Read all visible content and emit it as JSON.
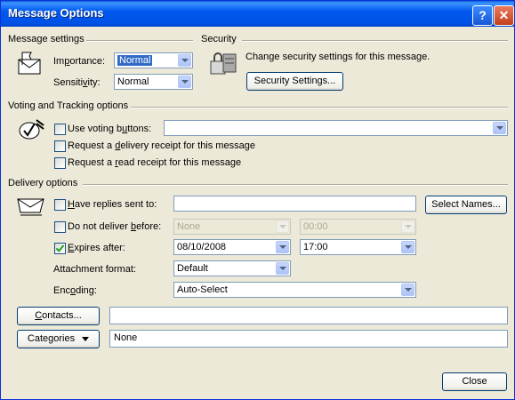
{
  "window": {
    "title": "Message Options",
    "help": "?",
    "close": "✕"
  },
  "message_settings": {
    "heading": "Message settings",
    "importance_label": "Importance:",
    "importance_value": "Normal",
    "sensitivity_label": "Sensitivity:",
    "sensitivity_value": "Normal"
  },
  "security": {
    "heading": "Security",
    "description": "Change security settings for this message.",
    "button": "Security Settings..."
  },
  "voting": {
    "heading": "Voting and Tracking options",
    "use_voting_label": "Use voting buttons:",
    "use_voting_value": "",
    "use_voting_checked": false,
    "delivery_receipt_label": "Request a delivery receipt for this message",
    "read_receipt_label": "Request a read receipt for this message"
  },
  "delivery": {
    "heading": "Delivery options",
    "have_replies_label": "Have replies sent to:",
    "have_replies_value": "",
    "select_names_button": "Select Names...",
    "do_not_deliver_label": "Do not deliver before:",
    "do_not_deliver_date": "None",
    "do_not_deliver_time": "00:00",
    "expires_label": "Expires after:",
    "expires_checked": true,
    "expires_date": "08/10/2008",
    "expires_time": "17:00",
    "attachment_label": "Attachment format:",
    "attachment_value": "Default",
    "encoding_label": "Encoding:",
    "encoding_value": "Auto-Select"
  },
  "contacts": {
    "button": "Contacts...",
    "value": ""
  },
  "categories": {
    "button": "Categories",
    "value": "None"
  },
  "footer": {
    "close_button": "Close"
  }
}
